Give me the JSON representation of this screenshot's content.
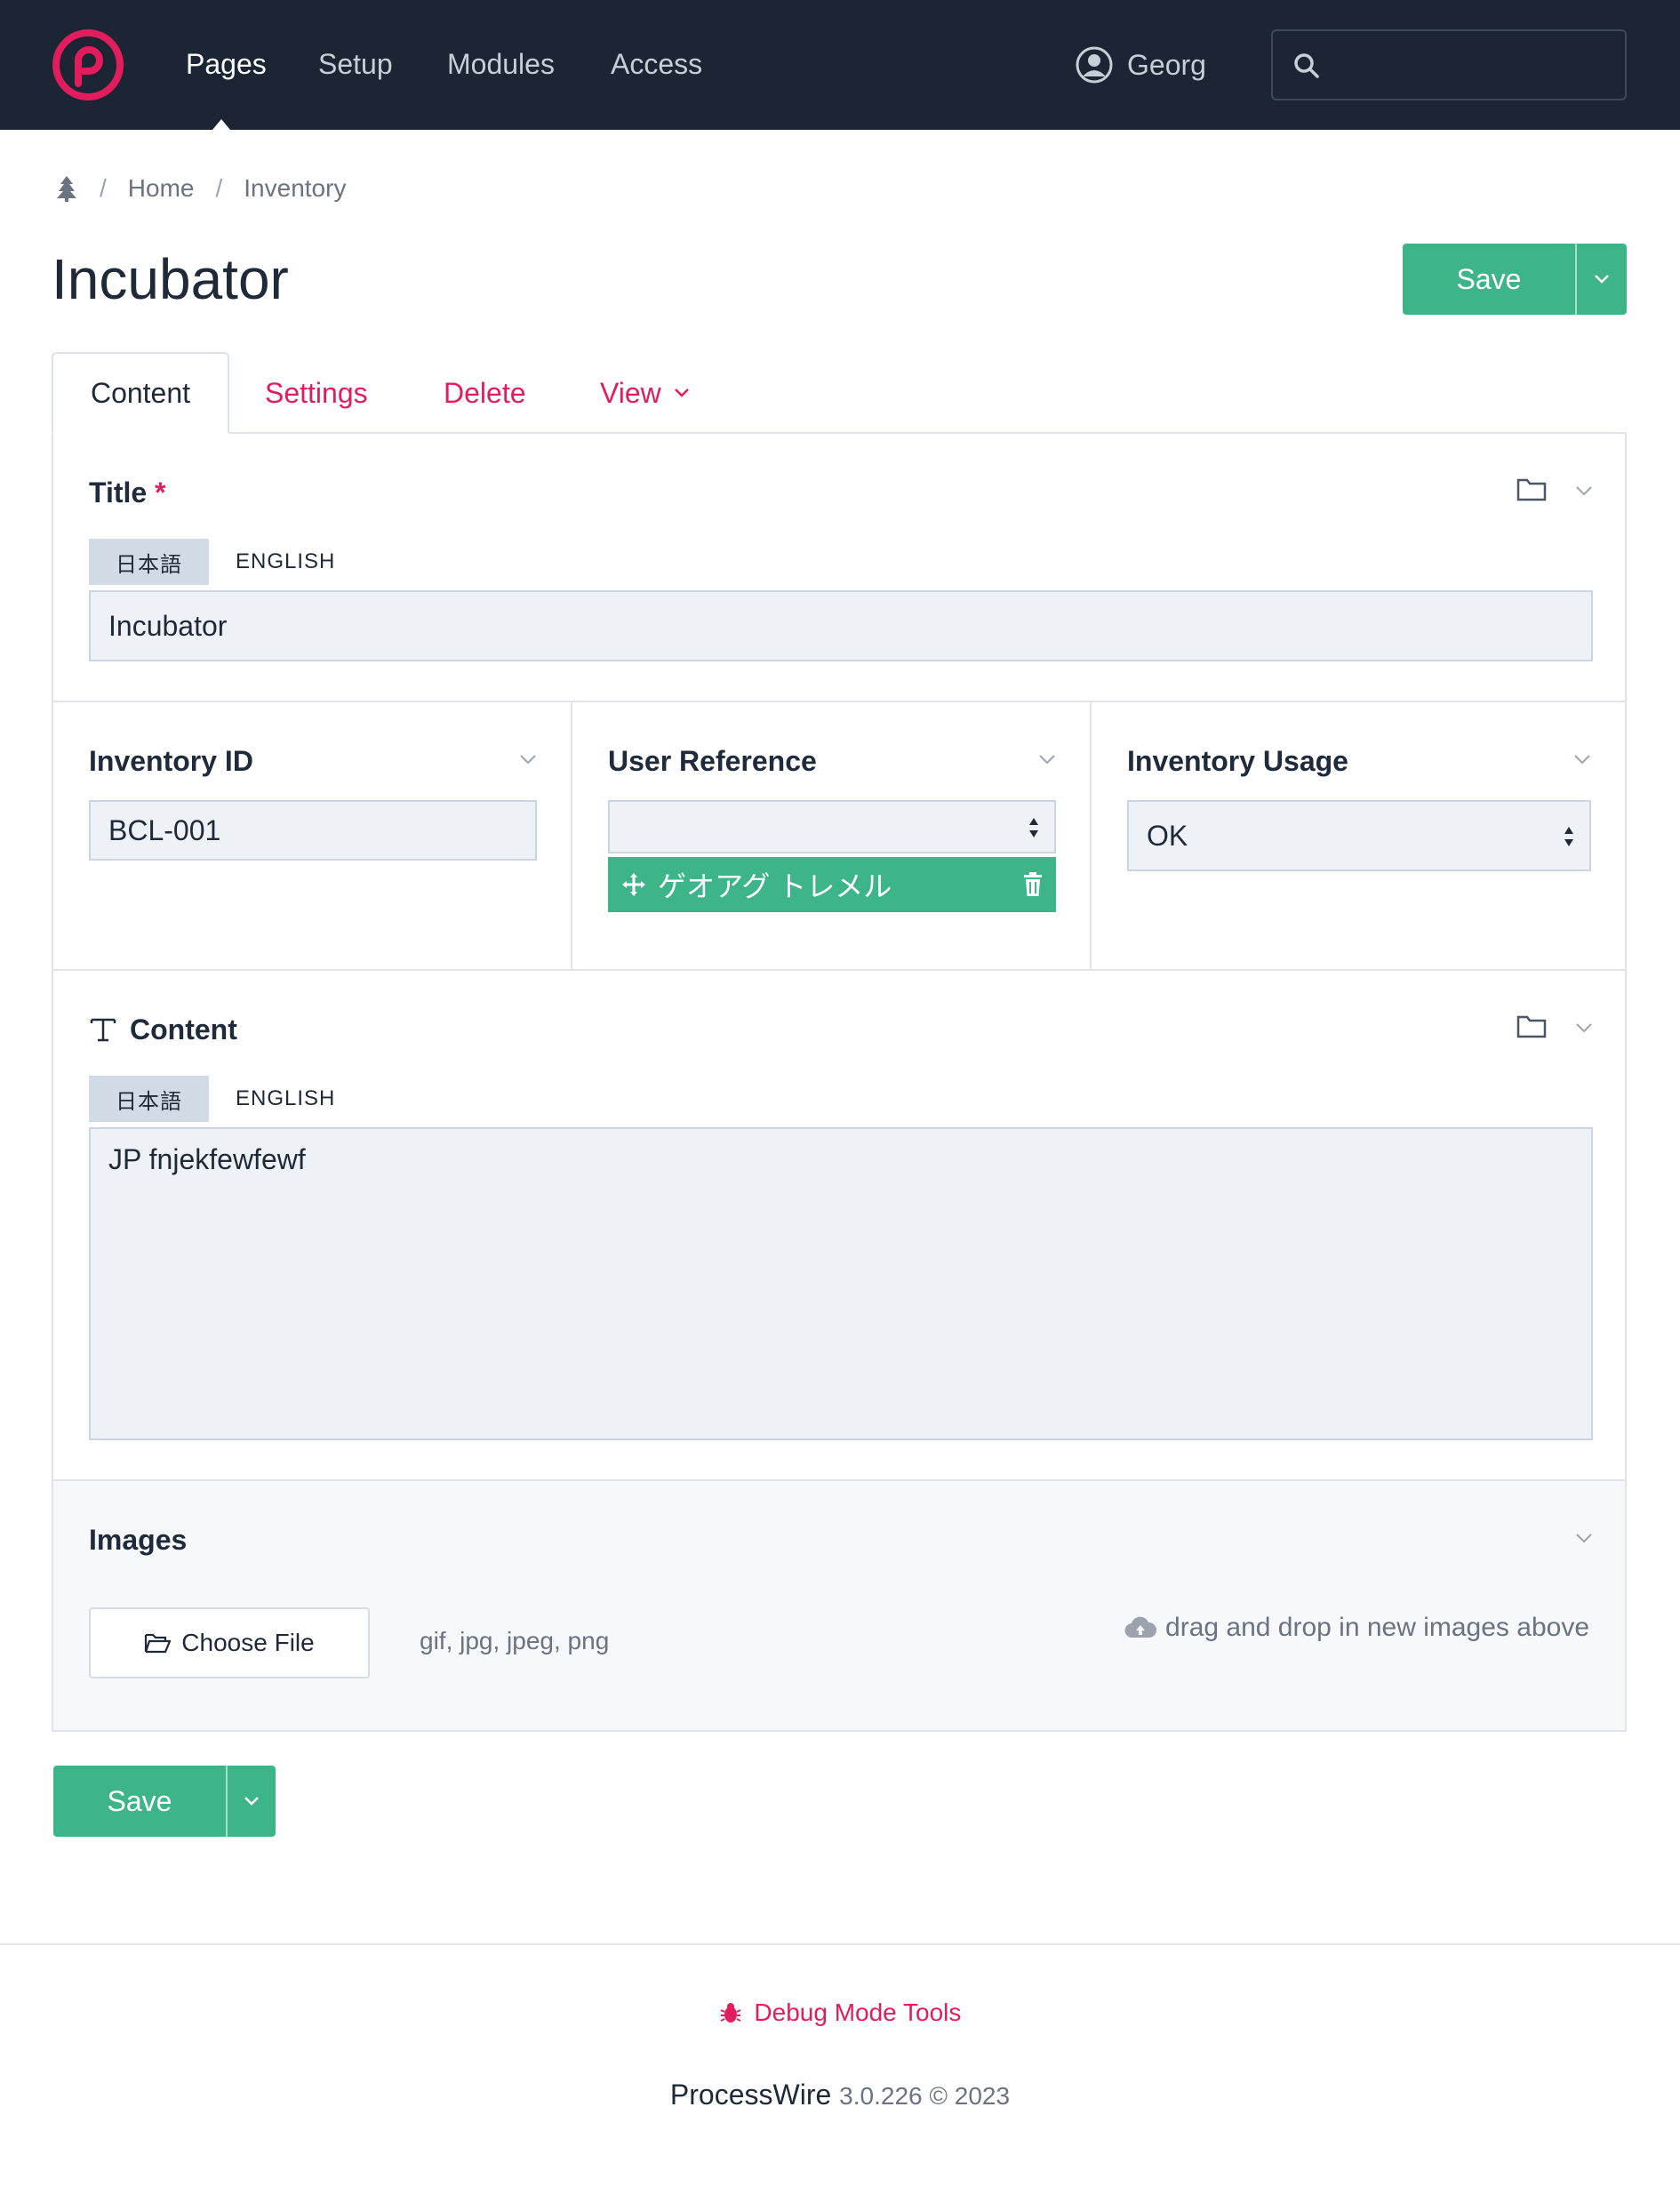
{
  "nav": {
    "items": [
      "Pages",
      "Setup",
      "Modules",
      "Access"
    ],
    "user_name": "Georg",
    "search_placeholder": ""
  },
  "breadcrumb": {
    "items": [
      "Home",
      "Inventory"
    ]
  },
  "page": {
    "title": "Incubator",
    "save_label": "Save"
  },
  "tabs": {
    "content": "Content",
    "settings": "Settings",
    "delete": "Delete",
    "view": "View"
  },
  "title_field": {
    "label": "Title",
    "required_mark": "*",
    "languages": [
      "日本語",
      "ENGLISH"
    ],
    "value": "Incubator"
  },
  "inventory_id": {
    "label": "Inventory ID",
    "value": "BCL-001"
  },
  "user_reference": {
    "label": "User Reference",
    "selected_value": "",
    "tags": [
      "ゲオアグ トレメル"
    ]
  },
  "inventory_usage": {
    "label": "Inventory Usage",
    "selected_value": "OK"
  },
  "content_field": {
    "label": "Content",
    "languages": [
      "日本語",
      "ENGLISH"
    ],
    "value": "JP fnjekfewfewf"
  },
  "images": {
    "label": "Images",
    "choose_label": "Choose File",
    "extensions": "gif, jpg, jpeg, png",
    "drop_hint": "drag and drop in new images above"
  },
  "footer": {
    "debug_label": "Debug Mode Tools",
    "product": "ProcessWire",
    "version": "3.0.226 © 2023"
  },
  "colors": {
    "accent": "#e11d5d",
    "save_green": "#3eb489",
    "masthead": "#1b2533"
  }
}
